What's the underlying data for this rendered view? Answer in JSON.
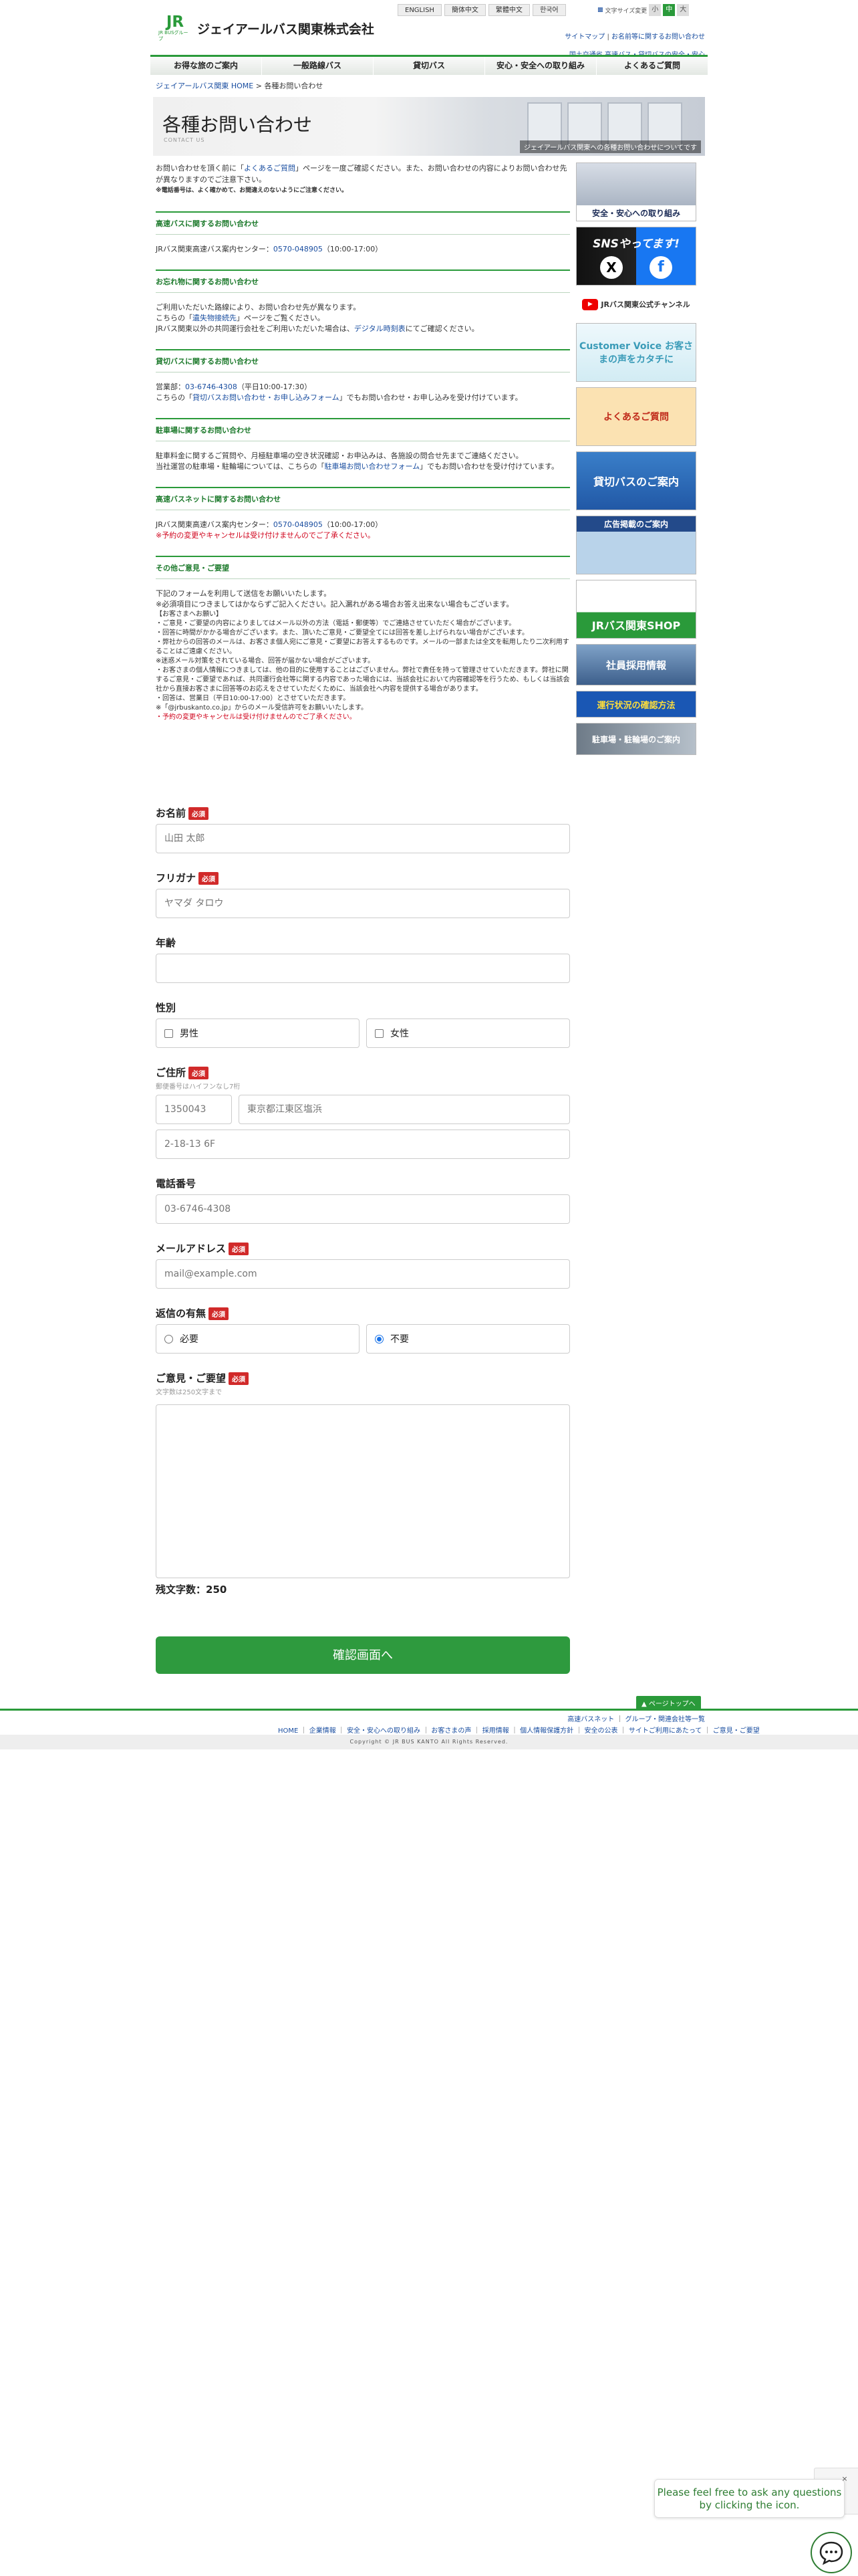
{
  "header": {
    "company_name": "ジェイアールバス関東株式会社",
    "logo_jr": "JR",
    "logo_group": "JR BUSグループ",
    "languages": [
      "ENGLISH",
      "簡体中文",
      "繁體中文",
      "한국어"
    ],
    "fontsize_label": "文字サイズ変更",
    "fontsize_options": [
      "小",
      "中",
      "大"
    ],
    "top_links": [
      "サイトマップ",
      "お名前等に関するお問い合わせ"
    ],
    "info_link": "国土交通省 高速バス・貸切バスの安全・安心"
  },
  "nav": [
    "お得な旅のご案内",
    "一般路線バス",
    "貸切バス",
    "安心・安全への取り組み",
    "よくあるご質問"
  ],
  "breadcrumb": {
    "home": "ジェイアールバス関東 HOME",
    "sep": ">",
    "current": "各種お問い合わせ"
  },
  "hero": {
    "title": "各種お問い合わせ",
    "subtitle": "CONTACT US",
    "caption": "ジェイアールバス関東への各種お問い合わせについてです"
  },
  "intro": {
    "text_before": "お問い合わせを頂く前に「",
    "link": "よくあるご質問",
    "text_after": "」ページを一度ご確認ください。また、お問い合わせの内容によりお問い合わせ先が異なりますのでご注意下さい。",
    "note": "※電話番号は、よく確かめて、お間違えのないようにご注意ください。"
  },
  "sections": [
    {
      "title": "高速バスに関するお問い合わせ",
      "line1": "JRバス関東高速バス案内センター：",
      "phone": "0570-048905",
      "hours": "（10:00-17:00）"
    },
    {
      "title": "お忘れ物に関するお問い合わせ",
      "line1": "ご利用いただいた路線により、お問い合わせ先が異なります。",
      "line2a": "こちらの「",
      "link": "遺失物接続先",
      "line2b": "」ページをご覧ください。",
      "line3a": "JRバス関東以外の共同運行会社をご利用いただいた場合は、",
      "link2": "デジタル時刻表",
      "line3b": "にてご確認ください。"
    },
    {
      "title": "貸切バスに関するお問い合わせ",
      "line1": "営業部：",
      "phone": "03-6746-4308",
      "hours": "（平日10:00-17:30）",
      "line2a": "こちらの「",
      "link": "貸切バスお問い合わせ・お申し込みフォーム",
      "line2b": "」でもお問い合わせ・お申し込みを受け付けています。"
    },
    {
      "title": "駐車場に関するお問い合わせ",
      "line1": "駐車料金に関するご質問や、月極駐車場の空き状況確認・お申込みは、各施設の問合せ先までご連絡ください。",
      "line2a": "当社運営の駐車場・駐輪場については、こちらの「",
      "link": "駐車場お問い合わせフォーム",
      "line2b": "」でもお問い合わせを受け付けています。"
    },
    {
      "title": "高速バスネットに関するお問い合わせ",
      "line1": "JRバス関東高速バス案内センター：",
      "phone": "0570-048905",
      "hours": "（10:00-17:00）",
      "red": "※予約の変更やキャンセルは受け付けませんのでご了承ください。"
    },
    {
      "title": "その他ご意見・ご要望"
    }
  ],
  "other": {
    "lines": [
      "下記のフォームを利用して送信をお願いいたします。",
      "※必須項目につきましてはかならずご記入ください。記入漏れがある場合お答え出来ない場合もございます。",
      "【お客さまへお願い】",
      "・ご意見・ご要望の内容によりましてはメール以外の方法（電話・郵便等）でご連絡させていただく場合がございます。",
      "・回答に時間がかかる場合がございます。また、頂いたご意見・ご要望全てには回答を差し上げられない場合がございます。",
      "・弊社からの回答のメールは、お客さま個人宛にご意見・ご要望にお答えするものです。メールの一部または全文を転用したり二次利用することはご遠慮ください。",
      "※迷惑メール対策をされている場合、回答が届かない場合がございます。",
      "・お客さまの個人情報につきましては、他の目的に使用することはございません。弊社で責任を持って管理させていただきます。弊社に関するご意見・ご要望であれば、共同運行会社等に関する内容であった場合には、当該会社において内容確認等を行うため、もしくは当該会社から直接お客さまに回答等のお応えをさせていただくために、当該会社へ内容を提供する場合があります。",
      "・回答は、営業日（平日10:00-17:00）とさせていただきます。",
      "※「@jrbuskanto.co.jp」からのメール受信許可をお願いいたします。"
    ],
    "red": "・予約の変更やキャンセルは受け付けませんのでご了承ください。"
  },
  "form": {
    "required_label": "必須",
    "name": {
      "label": "お名前",
      "placeholder": "山田 太郎"
    },
    "kana": {
      "label": "フリガナ",
      "placeholder": "ヤマダ タロウ"
    },
    "age": {
      "label": "年齢",
      "placeholder": ""
    },
    "gender": {
      "label": "性別",
      "options": [
        "男性",
        "女性"
      ]
    },
    "address": {
      "label": "ご住所",
      "hint": "郵便番号はハイフンなし7桁",
      "zip_placeholder": "1350043",
      "city_placeholder": "東京都江東区塩浜",
      "street_placeholder": "2-18-13 6F"
    },
    "phone": {
      "label": "電話番号",
      "placeholder": "03-6746-4308"
    },
    "email": {
      "label": "メールアドレス",
      "placeholder": "mail@example.com"
    },
    "reply": {
      "label": "返信の有無",
      "options": [
        "必要",
        "不要"
      ],
      "selected": "不要"
    },
    "message": {
      "label": "ご意見・ご要望",
      "hint": "文字数は250文字まで",
      "placeholder": ""
    },
    "count_label": "残文字数：250",
    "submit": "確認画面へ"
  },
  "sidebar": [
    {
      "label": "安全・安心への取り組み"
    },
    {
      "label": "SNSやってます!"
    },
    {
      "label": "JRバス関東公式チャンネル"
    },
    {
      "label": "Customer Voice お客さまの声をカタチに"
    },
    {
      "label": "よくあるご質問"
    },
    {
      "label": "貸切バスのご案内"
    },
    {
      "label": "広告掲載のご案内"
    },
    {
      "label": "JRバス関東SHOP"
    },
    {
      "label": "社員採用情報"
    },
    {
      "label": "運行状況の確認方法"
    },
    {
      "label": "駐車場・駐輪場のご案内"
    }
  ],
  "footer": {
    "totop": "ページトップへ",
    "links1": [
      "高速バスネット",
      "グループ・関連会社等一覧"
    ],
    "links2": [
      "HOME",
      "企業情報",
      "安全・安心への取り組み",
      "お客さまの声",
      "採用情報",
      "個人情報保護方針",
      "安全の公表",
      "サイトご利用にあたって",
      "ご意見・ご要望"
    ],
    "copyright": "Copyright © JR BUS KANTO All Rights Reserved."
  },
  "chat": {
    "message": "Please feel free to ask any questions by clicking the icon.",
    "close": "×"
  },
  "colors": {
    "brand_green": "#2a9a3a",
    "required_red": "#d12a2a",
    "link_blue": "#1a4ea0"
  }
}
